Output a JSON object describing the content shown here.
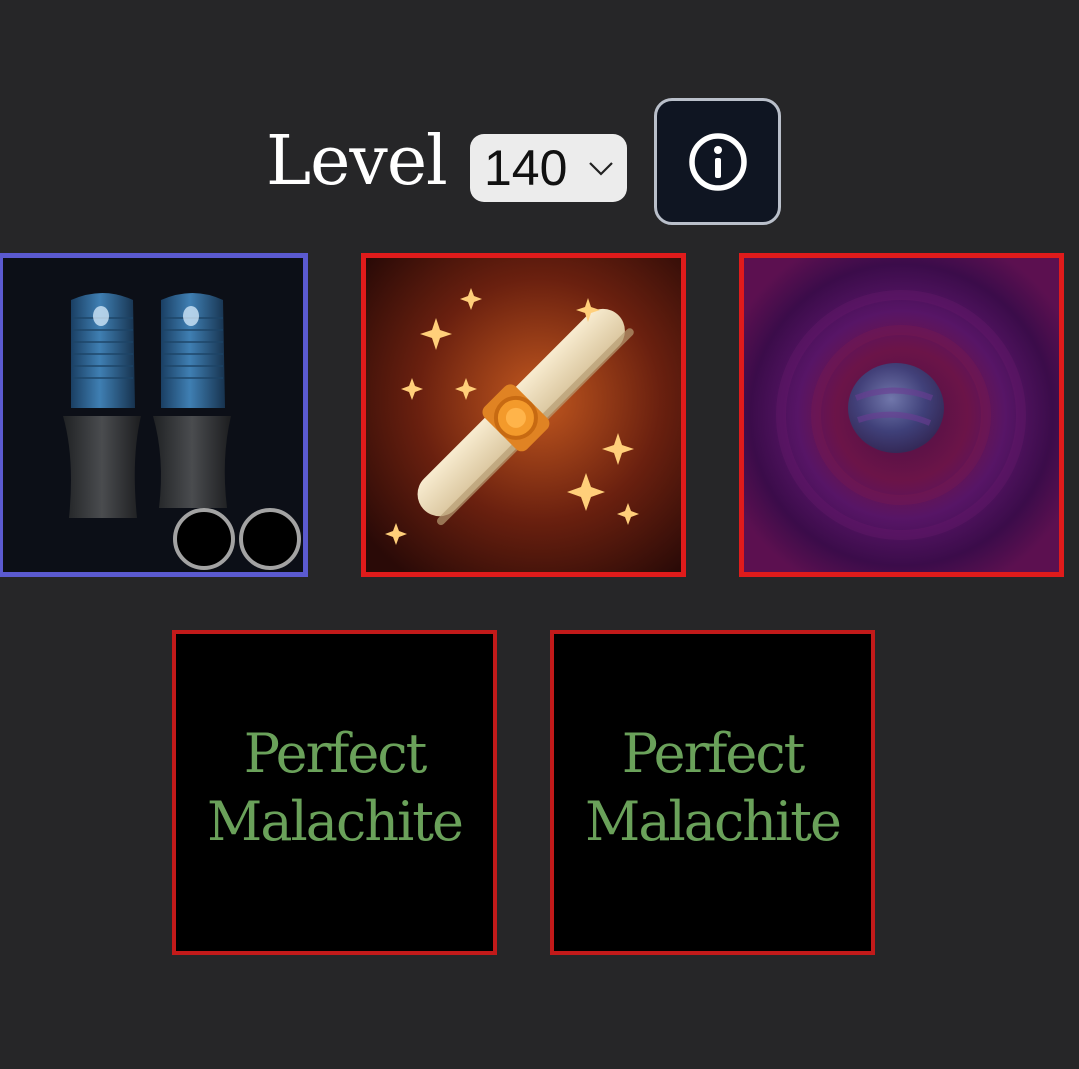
{
  "level": {
    "label": "Level",
    "selected": "140"
  },
  "icons": {
    "info": "info-circle-icon",
    "dropdown": "chevron-down-icon"
  },
  "colors": {
    "background": "#262628",
    "border_blue": "#5b5ad0",
    "border_red": "#e01b1b",
    "gem_text": "#6aa15a"
  },
  "items": [
    {
      "id": "boots",
      "icon": "boots-icon",
      "border": "#5b5ad0",
      "sockets": 2
    },
    {
      "id": "scroll",
      "icon": "scroll-icon",
      "border": "#e01b1b"
    },
    {
      "id": "orb",
      "icon": "orb-icon",
      "border": "#e01b1b"
    }
  ],
  "gems": [
    {
      "line1": "Perfect",
      "line2": "Malachite"
    },
    {
      "line1": "Perfect",
      "line2": "Malachite"
    }
  ]
}
